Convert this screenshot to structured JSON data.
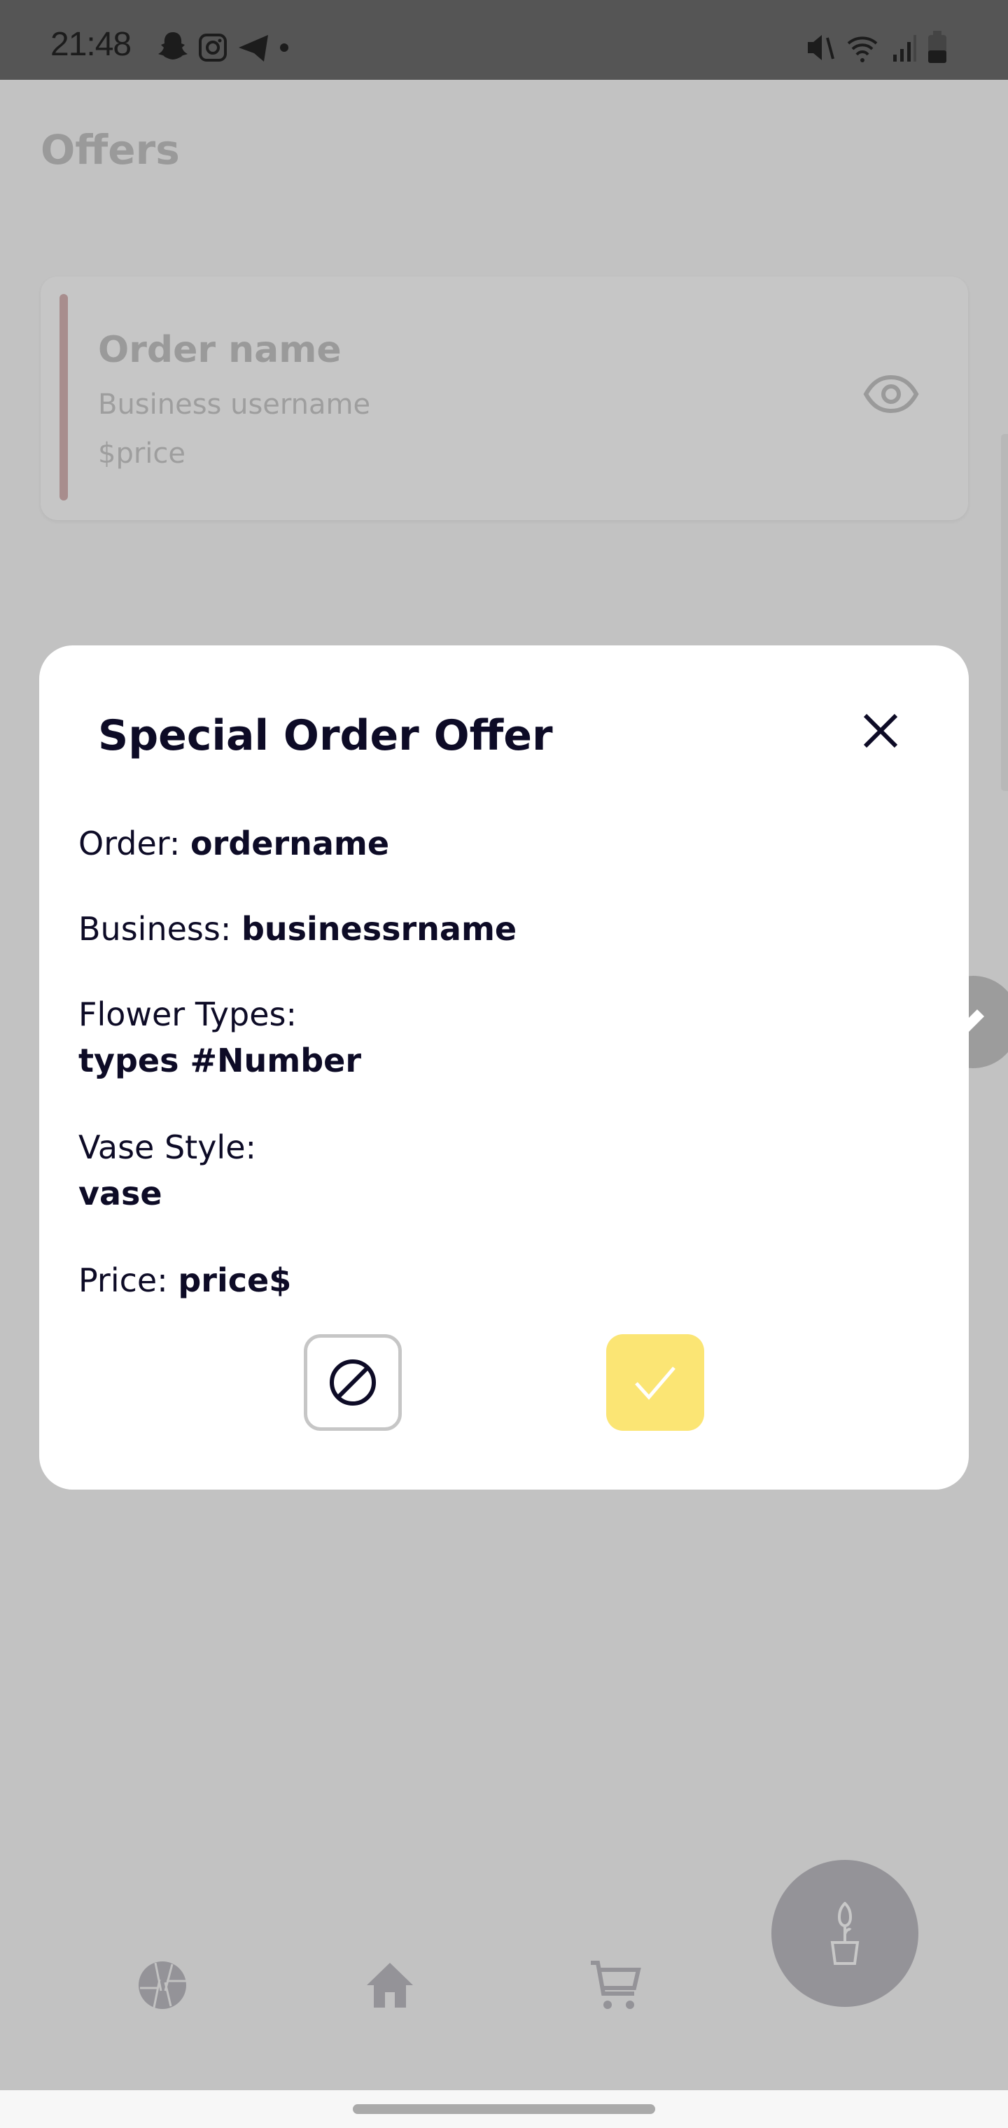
{
  "status_bar": {
    "time": "21:48"
  },
  "page": {
    "title": "Offers"
  },
  "offer_card": {
    "order_name": "Order name",
    "business": "Business username",
    "price": "$price"
  },
  "dialog": {
    "title": "Special Order Offer",
    "order_label": "Order: ",
    "order_value": "ordername",
    "business_label": "Business: ",
    "business_value": "businessrname",
    "flower_label": "Flower Types:",
    "flower_value": "types #Number",
    "vase_label": "Vase Style:",
    "vase_value": "vase",
    "price_label": "Price: ",
    "price_value": "price$"
  },
  "colors": {
    "accent": "#fbe574",
    "text": "#0d0b26",
    "card_bar": "#a88d8d"
  }
}
